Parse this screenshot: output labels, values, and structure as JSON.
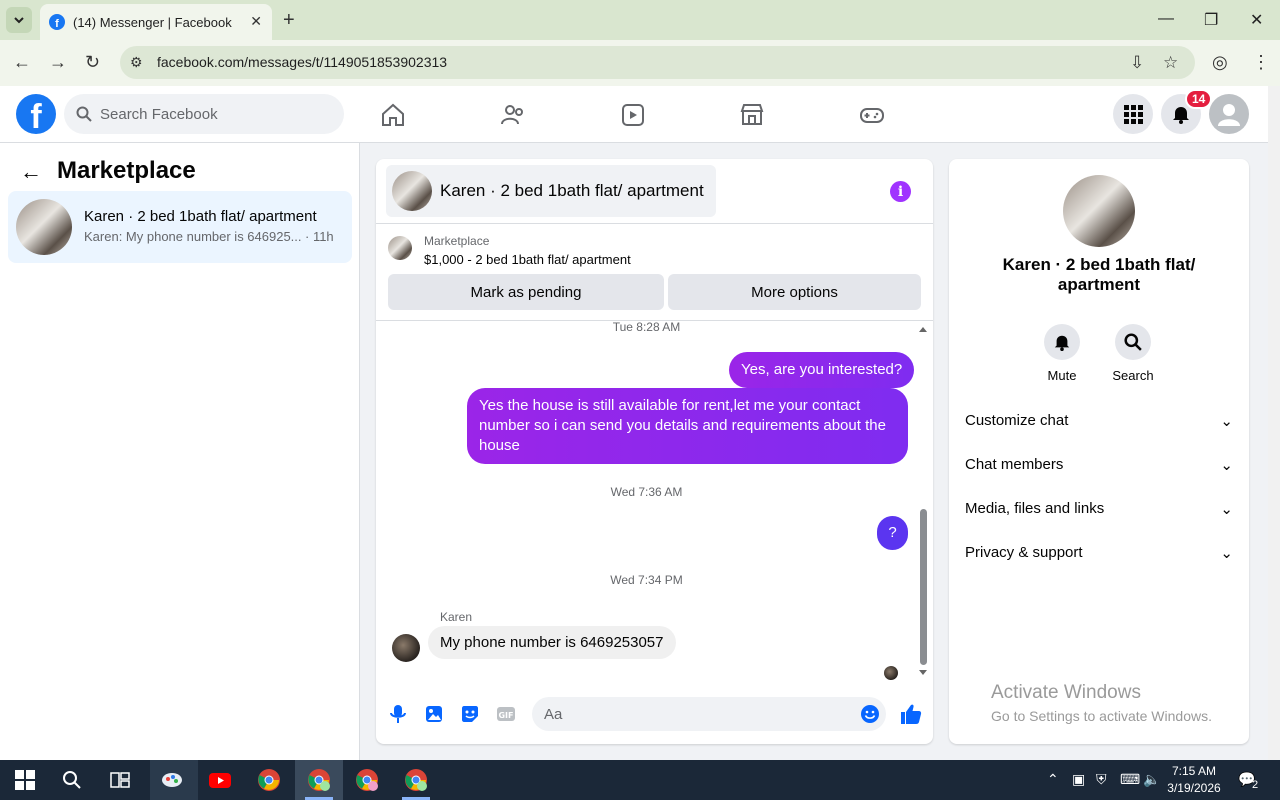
{
  "browser": {
    "tab_title": "(14) Messenger | Facebook",
    "url": "facebook.com/messages/t/1149051853902313"
  },
  "fb_header": {
    "search_placeholder": "Search Facebook",
    "notification_count": "14"
  },
  "left_panel": {
    "title": "Marketplace",
    "conversation": {
      "name": "Karen · 2 bed 1bath flat/ apartment",
      "snippet": "Karen: My phone number is 646925...",
      "time": "· 11h"
    }
  },
  "chat": {
    "header_name": "Karen · 2 bed 1bath flat/ apartment",
    "listing_source": "Marketplace",
    "listing_title": "$1,000 - 2 bed 1bath flat/ apartment",
    "mark_pending": "Mark as pending",
    "more_options": "More options",
    "timestamps": [
      "Tue 8:28 AM",
      "Wed 7:36 AM",
      "Wed 7:34 PM"
    ],
    "messages": [
      {
        "dir": "out",
        "text": "Yes, are you interested?"
      },
      {
        "dir": "out",
        "text": "Yes the house is still available for rent,let me your contact number so i can send you details and requirements about the house"
      },
      {
        "dir": "out",
        "text": "?"
      },
      {
        "dir": "in",
        "sender": "Karen",
        "text": "My phone number is 6469253057"
      }
    ],
    "composer_placeholder": "Aa"
  },
  "right_panel": {
    "name": "Karen · 2 bed 1bath flat/ apartment",
    "mute": "Mute",
    "search": "Search",
    "sections": [
      "Customize chat",
      "Chat members",
      "Media, files and links",
      "Privacy & support"
    ]
  },
  "watermark": {
    "line1": "Activate Windows",
    "line2": "Go to Settings to activate Windows."
  },
  "taskbar": {
    "time": "7:15 AM",
    "date": "3/19/2026",
    "notif_count": "2"
  },
  "colors": {
    "fb_blue": "#1877f2",
    "bubble_purple": "#8a2be2",
    "badge_red": "#e41e3f"
  }
}
